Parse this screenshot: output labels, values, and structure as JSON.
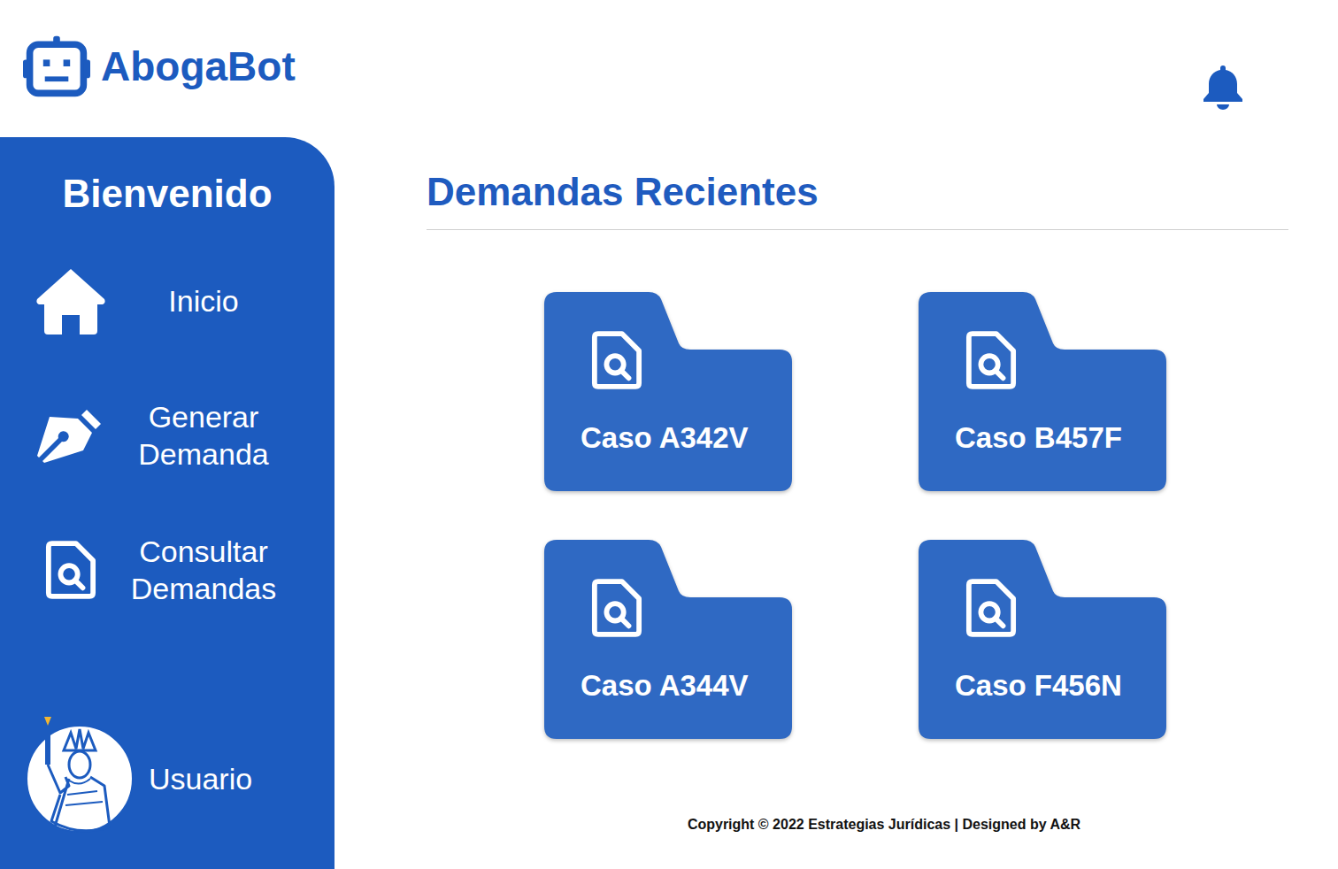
{
  "app": {
    "name": "AbogaBot"
  },
  "sidebar": {
    "greeting": "Bienvenido",
    "items": [
      {
        "label": "Inicio",
        "kind": "home"
      },
      {
        "label": "Generar Demanda",
        "kind": "pen"
      },
      {
        "label": "Consultar Demandas",
        "kind": "search"
      }
    ],
    "user": {
      "label": "Usuario"
    }
  },
  "main": {
    "title": "Demandas Recientes",
    "cases": [
      {
        "label": "Caso A342V"
      },
      {
        "label": "Caso B457F"
      },
      {
        "label": "Caso A344V"
      },
      {
        "label": "Caso F456N"
      }
    ]
  },
  "footer": "Copyright © 2022 Estrategias Jurídicas | Designed by A&R"
}
